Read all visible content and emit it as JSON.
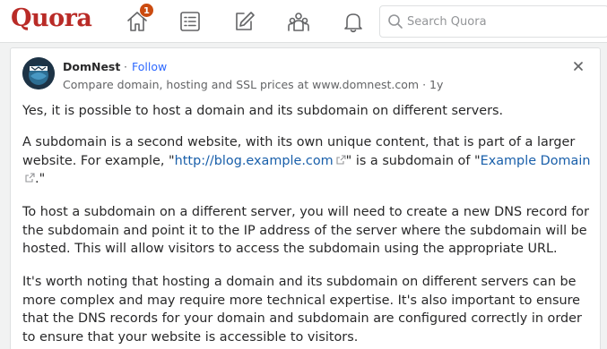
{
  "header": {
    "logo": "Quora",
    "notification_count": "1",
    "search_placeholder": "Search Quora"
  },
  "post": {
    "author": "DomNest",
    "separator": "·",
    "follow_label": "Follow",
    "credential": "Compare domain, hosting and SSL prices at www.domnest.com · 1y",
    "p1": "Yes, it is possible to host a domain and its subdomain on different servers.",
    "p2_a": "A subdomain is a second website, with its own unique content, that is part of a larger website. For example, \"",
    "p2_link1": "http://blog.example.com",
    "p2_b": "\" is a subdomain of \"",
    "p2_link2": "Example Domain",
    "p2_c": ".\"",
    "p3": "To host a subdomain on a different server, you will need to create a new DNS record for the subdomain and point it to the IP address of the server where the subdomain will be hosted. This will allow visitors to access the subdomain using the appropriate URL.",
    "p4": "It's worth noting that hosting a domain and its subdomain on different servers can be more complex and may require more technical expertise. It's also important to ensure that the DNS records for your domain and subdomain are configured correctly in order to ensure that your website is accessible to visitors."
  },
  "icons": [
    "home-icon",
    "list-icon",
    "edit-icon",
    "spaces-icon",
    "bell-icon",
    "search-icon",
    "close-icon",
    "external-link-icon"
  ],
  "colors": {
    "brand": "#b92b27",
    "link": "#195faa",
    "follow": "#2e69ff",
    "badge": "#cb4b10"
  }
}
